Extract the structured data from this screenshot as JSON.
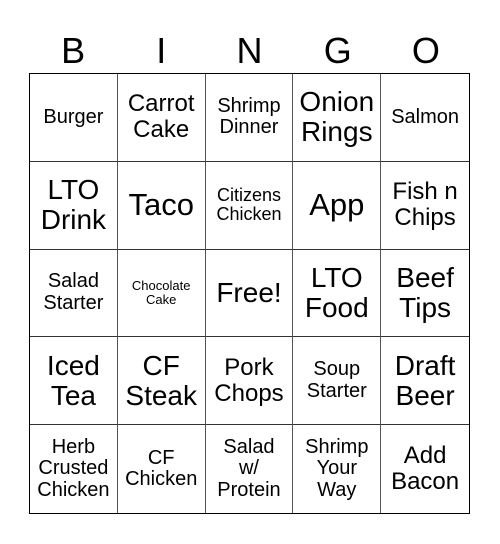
{
  "header": [
    "B",
    "I",
    "N",
    "G",
    "O"
  ],
  "cells": [
    {
      "text": "Burger",
      "size": "s3"
    },
    {
      "text": "Carrot\nCake",
      "size": "s4"
    },
    {
      "text": "Shrimp\nDinner",
      "size": "s3"
    },
    {
      "text": "Onion\nRings",
      "size": "s5"
    },
    {
      "text": "Salmon",
      "size": "s3"
    },
    {
      "text": "LTO\nDrink",
      "size": "s5"
    },
    {
      "text": "Taco",
      "size": "s6"
    },
    {
      "text": "Citizens\nChicken",
      "size": "s2"
    },
    {
      "text": "App",
      "size": "s6"
    },
    {
      "text": "Fish n\nChips",
      "size": "s4"
    },
    {
      "text": "Salad\nStarter",
      "size": "s3"
    },
    {
      "text": "Chocolate\nCake",
      "size": "s1"
    },
    {
      "text": "Free!",
      "size": "s5"
    },
    {
      "text": "LTO\nFood",
      "size": "s5"
    },
    {
      "text": "Beef\nTips",
      "size": "s5"
    },
    {
      "text": "Iced\nTea",
      "size": "s5"
    },
    {
      "text": "CF\nSteak",
      "size": "s5"
    },
    {
      "text": "Pork\nChops",
      "size": "s4"
    },
    {
      "text": "Soup\nStarter",
      "size": "s3"
    },
    {
      "text": "Draft\nBeer",
      "size": "s5"
    },
    {
      "text": "Herb\nCrusted\nChicken",
      "size": "s3"
    },
    {
      "text": "CF\nChicken",
      "size": "s3"
    },
    {
      "text": "Salad\nw/\nProtein",
      "size": "s3"
    },
    {
      "text": "Shrimp\nYour\nWay",
      "size": "s3"
    },
    {
      "text": "Add\nBacon",
      "size": "s4"
    }
  ]
}
